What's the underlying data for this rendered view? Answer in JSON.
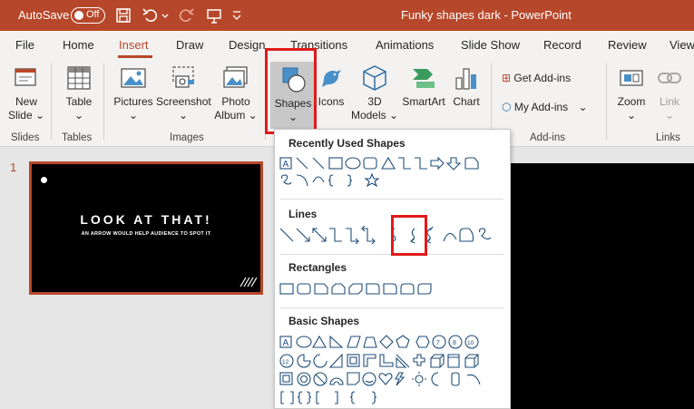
{
  "titlebar": {
    "autosave": "AutoSave",
    "toggle": "Off",
    "doc_title": "Funky shapes dark  -  PowerPoint"
  },
  "tabs": [
    "File",
    "Home",
    "Insert",
    "Draw",
    "Design",
    "Transitions",
    "Animations",
    "Slide Show",
    "Record",
    "Review",
    "View"
  ],
  "active_tab": "Insert",
  "ribbon": {
    "new_slide": [
      "New",
      "Slide"
    ],
    "table": "Table",
    "pictures": "Pictures",
    "screenshot": "Screenshot",
    "photo_album": [
      "Photo",
      "Album"
    ],
    "shapes": "Shapes",
    "icons": "Icons",
    "models": [
      "3D",
      "Models"
    ],
    "smartart": "SmartArt",
    "chart": "Chart",
    "get_addins": "Get Add-ins",
    "my_addins": "My Add-ins",
    "zoom": "Zoom",
    "link": "Link",
    "groups": {
      "slides": "Slides",
      "tables": "Tables",
      "images": "Images",
      "addins": "Add-ins",
      "links": "Links"
    }
  },
  "slide": {
    "number": "1",
    "title": "LOOK AT THAT!",
    "subtitle": "AN ARROW WOULD HELP AUDIENCE TO SPOT IT"
  },
  "dropdown": {
    "recent": "Recently Used Shapes",
    "lines": "Lines",
    "rectangles": "Rectangles",
    "basic": "Basic Shapes"
  },
  "colors": {
    "accent": "#b7472a",
    "highlight": "#e01a1a",
    "shape_stroke": "#1f4e79"
  }
}
